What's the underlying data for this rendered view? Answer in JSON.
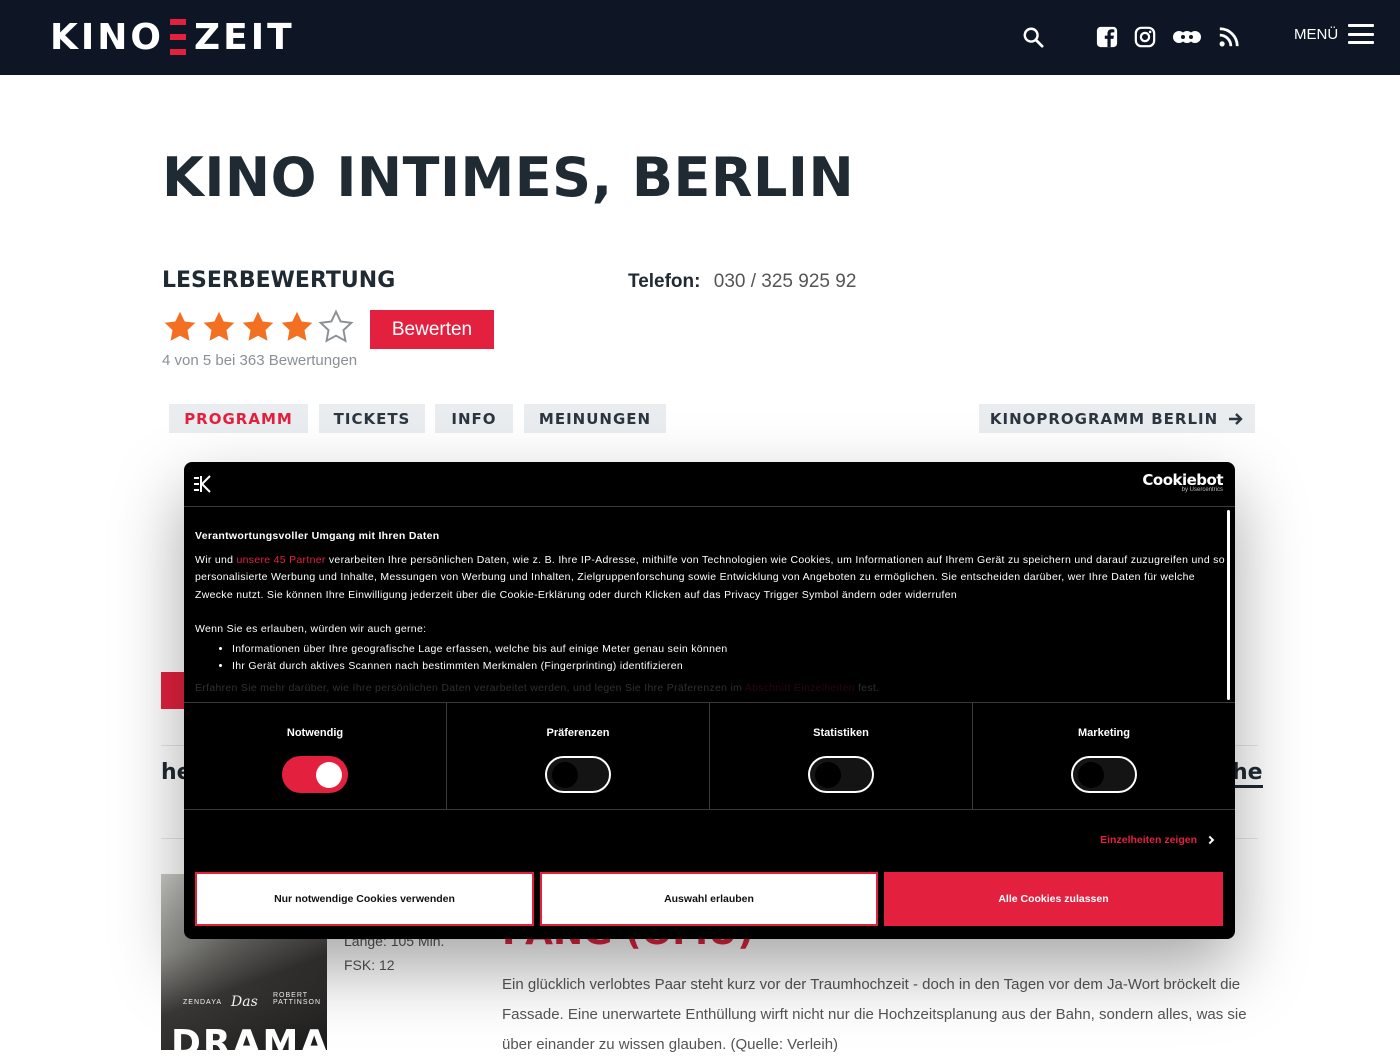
{
  "header": {
    "logo_left": "KINO",
    "logo_right": "ZEIT",
    "menu_label": "MENÜ",
    "icons": [
      "search-icon",
      "facebook-icon",
      "instagram-icon",
      "letterboxd-icon",
      "rss-icon"
    ]
  },
  "page": {
    "title": "KINO INTIMES, BERLIN",
    "rating_heading": "LESERBEWERTUNG",
    "rating": {
      "value": 4,
      "max": 5,
      "summary": "4 von 5 bei 363 Bewertungen"
    },
    "rate_button": "Bewerten",
    "phone_label": "Telefon:",
    "phone_value": "030 / 325 925 92"
  },
  "tabs": [
    {
      "label": "PROGRAMM",
      "active": true
    },
    {
      "label": "TICKETS",
      "active": false
    },
    {
      "label": "INFO",
      "active": false
    },
    {
      "label": "MEINUNGEN",
      "active": false
    }
  ],
  "program_link": "KINOPROGRAMM BERLIN",
  "behind": {
    "he_left": "he",
    "he_right": "he",
    "meta_length": "Länge: 105 Min.",
    "meta_fsk": "FSK: 12",
    "movie_title": "PANG (OMU)",
    "movie_desc": "Ein glücklich verlobtes Paar steht kurz vor der Traumhochzeit - doch in den Tagen vor dem Ja-Wort bröckelt die Fassade. Eine unerwartete Enthüllung wirft nicht nur die Hochzeitsplanung aus der Bahn, sondern alles, was sie über einander zu wissen glauben. (Quelle: Verleih)",
    "poster_credit_left": "ZENDAYA",
    "poster_credit_right": "ROBERT PATTINSON",
    "poster_small": "Das",
    "poster_big": "DRAMA"
  },
  "cookie": {
    "brand": "Cookiebot",
    "brand_sub": "by Usercentrics",
    "heading": "Verantwortungsvoller Umgang mit Ihren Daten",
    "p1_pre": "Wir und ",
    "p1_link": "unsere 45 Partner",
    "p1_post": " verarbeiten Ihre persönlichen Daten, wie z. B. Ihre IP-Adresse, mithilfe von Technologien wie Cookies, um Informationen auf Ihrem Gerät zu speichern und darauf zuzugreifen und so personalisierte Werbung und Inhalte, Messungen von Werbung und Inhalten, Zielgruppenforschung sowie Entwicklung von Angeboten zu ermöglichen. Sie entscheiden darüber, wer Ihre Daten für welche Zwecke nutzt. Sie können Ihre Einwilligung jederzeit über die Cookie-Erklärung oder durch Klicken auf das Privacy Trigger Symbol ändern oder widerrufen",
    "p2": "Wenn Sie es erlauben, würden wir auch gerne:",
    "bullets": [
      "Informationen über Ihre geografische Lage erfassen, welche bis auf einige Meter genau sein können",
      "Ihr Gerät durch aktives Scannen nach bestimmten Merkmalen (Fingerprinting) identifizieren"
    ],
    "p3_pre": "Erfahren Sie mehr darüber, wie Ihre persönlichen Daten verarbeitet werden, und legen Sie Ihre Präferenzen im ",
    "p3_link": "Abschnitt Einzelheiten",
    "p3_post": " fest.",
    "categories": [
      {
        "label": "Notwendig",
        "on": true
      },
      {
        "label": "Präferenzen",
        "on": false
      },
      {
        "label": "Statistiken",
        "on": false
      },
      {
        "label": "Marketing",
        "on": false
      }
    ],
    "details_link": "Einzelheiten zeigen",
    "btn_necessary": "Nur notwendige Cookies verwenden",
    "btn_selection": "Auswahl erlauben",
    "btn_all": "Alle Cookies zulassen"
  },
  "colors": {
    "accent": "#e3213f",
    "header_bg": "#0e1626",
    "star": "#f36f21"
  }
}
